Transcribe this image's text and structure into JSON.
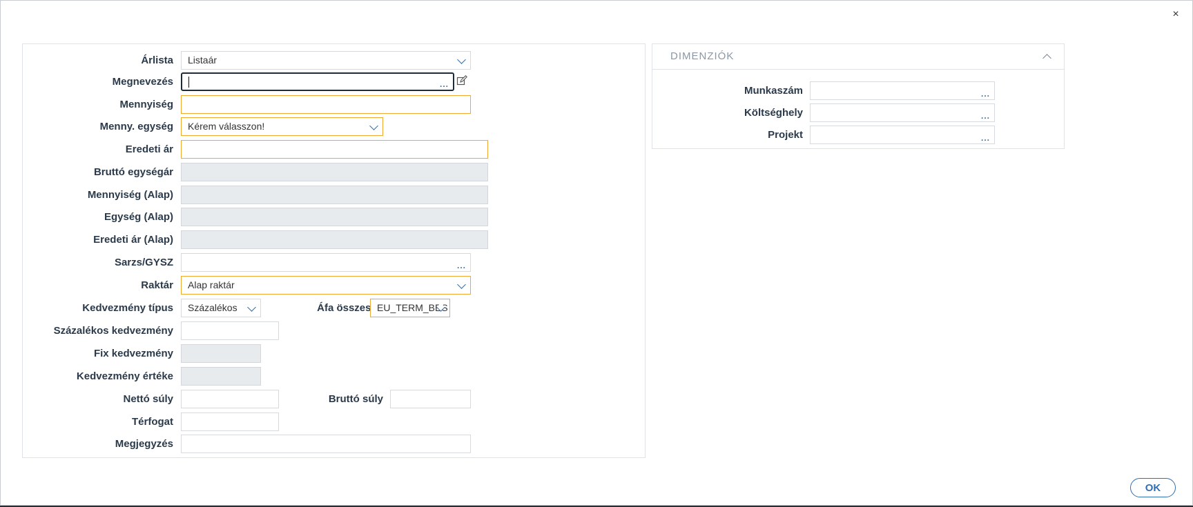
{
  "window": {
    "close_label": "×"
  },
  "form": {
    "arlista": {
      "label": "Árlista",
      "value": "Listaár"
    },
    "megnevezes": {
      "label": "Megnevezés",
      "value": ""
    },
    "mennyiseg": {
      "label": "Mennyiség",
      "value": ""
    },
    "menny_egyseg": {
      "label": "Menny. egység",
      "value": "Kérem válasszon!"
    },
    "eredeti_ar": {
      "label": "Eredeti ár",
      "value": ""
    },
    "brutto_egysegar": {
      "label": "Bruttó egységár",
      "value": ""
    },
    "mennyiseg_alap": {
      "label": "Mennyiség (Alap)",
      "value": ""
    },
    "egyseg_alap": {
      "label": "Egység (Alap)",
      "value": ""
    },
    "eredeti_ar_alap": {
      "label": "Eredeti ár (Alap)",
      "value": ""
    },
    "sarzs": {
      "label": "Sarzs/GYSZ",
      "value": ""
    },
    "raktar": {
      "label": "Raktár",
      "value": "Alap raktár"
    },
    "kedvezmeny_tipus": {
      "label": "Kedvezmény típus",
      "value": "Százalékos"
    },
    "afa_osszesen": {
      "label": "Áfa összesen",
      "value": "EU_TERM_BES"
    },
    "szazalekos_kedvezmeny": {
      "label": "Százalékos kedvezmény",
      "value": ""
    },
    "fix_kedvezmeny": {
      "label": "Fix kedvezmény",
      "value": ""
    },
    "kedvezmeny_erteke": {
      "label": "Kedvezmény értéke",
      "value": ""
    },
    "netto_suly": {
      "label": "Nettó súly",
      "value": ""
    },
    "brutto_suly": {
      "label": "Bruttó súly",
      "value": ""
    },
    "terfogat": {
      "label": "Térfogat",
      "value": ""
    },
    "megjegyzes": {
      "label": "Megjegyzés",
      "value": ""
    },
    "lookup_dots": "..."
  },
  "dimensions": {
    "title": "DIMENZIÓK",
    "munkaszam": {
      "label": "Munkaszám",
      "value": ""
    },
    "koltseghely": {
      "label": "Költséghely",
      "value": ""
    },
    "projekt": {
      "label": "Projekt",
      "value": ""
    }
  },
  "footer": {
    "ok_label": "OK"
  },
  "colors": {
    "required_border": "#f0a830",
    "accent": "#2f6fb3",
    "readonly_bg": "#e8ebee"
  }
}
